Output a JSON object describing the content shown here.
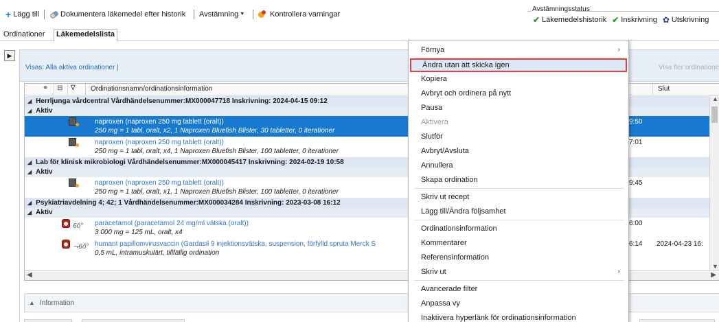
{
  "toolbar": {
    "add": "Lägg till",
    "document": "Dokumentera läkemedel efter historik",
    "reconcile": "Avstämning",
    "warnings": "Kontrollera varningar"
  },
  "status": {
    "title": "Avstämningsstatus",
    "items": [
      "Läkemedelshistorik",
      "Inskrivning",
      "Utskrivning"
    ]
  },
  "tabs": [
    "Ordinationer",
    "Läkemedelslista"
  ],
  "list": {
    "filter_text": "Visas: Alla aktiva ordinationer  |",
    "more_link": "Visa fler ordinationer",
    "col_name": "Ordinationsnamn/ordinationsinformation",
    "col_end": "Slut",
    "groups": [
      {
        "header": "Herrljunga vårdcentral  Vårdhändelsenummer:MX000047718  Inskrivning: 2024-04-15 09:12",
        "status": "Aktiv",
        "rows": [
          {
            "line1": "naproxen (naproxen 250 mg tablett (oralt))",
            "line2": "250 mg = 1 tabl, oralt, x2, 1 Naproxen Bluefish Blister, 30 tabletter, 0 iterationer",
            "time": "9:50",
            "end": ""
          },
          {
            "line1": "naproxen (naproxen 250 mg tablett (oralt))",
            "line2": "250 mg = 1 tabl, oralt, x4, 1 Naproxen Bluefish Blister, 100 tabletter, 0 iterationer",
            "time": "7:01",
            "end": ""
          }
        ]
      },
      {
        "header": "Lab för klinisk mikrobiologi  Vårdhändelsenummer:MX000045417  Inskrivning: 2024-02-19 10:58",
        "status": "Aktiv",
        "rows": [
          {
            "line1": "naproxen (naproxen 250 mg tablett (oralt))",
            "line2": "250 mg = 1 tabl, oralt, x1, 1 Naproxen Bluefish Blister, 100 tabletter, 0 iterationer",
            "time": "9:45",
            "end": ""
          }
        ]
      },
      {
        "header": "Psykiatriavdelning 4; 42; 1  Vårdhändelsenummer:MX000034284  Inskrivning: 2023-03-08 16:12",
        "status": "Aktiv",
        "rows": [
          {
            "line1": "paracetamol (paracetamol 24 mg/ml vätska (oralt))",
            "line2": "3 000 mg = 125 mL, oralt, x4",
            "time": "6:00",
            "end": ""
          },
          {
            "line1": "humant papillomvirusvaccin (Gardasil 9 injektionsvätska, suspension, förfylld spruta Merck S",
            "line2": "0,5 mL, intramuskulärt, tillfällig ordination",
            "time": "6:14",
            "end": "2024-04-23 16:"
          }
        ]
      }
    ]
  },
  "info_label": "Information",
  "context_menu": {
    "items": [
      {
        "label": "Förnya",
        "submenu": true
      },
      {
        "label": "Ändra utan att skicka igen",
        "highlighted": true
      },
      {
        "label": "Kopiera"
      },
      {
        "label": "Avbryt och ordinera på nytt"
      },
      {
        "label": "Pausa"
      },
      {
        "label": "Aktivera",
        "disabled": true
      },
      {
        "label": "Slutför"
      },
      {
        "label": "Avbryt/Avsluta"
      },
      {
        "label": "Annullera"
      },
      {
        "label": "Skapa ordination"
      },
      {
        "label": "Skriv ut recept"
      },
      {
        "label": "Lägg till/Ändra följsamhet"
      },
      {
        "label": "Ordinationsinformation"
      },
      {
        "label": "Kommentarer"
      },
      {
        "label": "Referensinformation"
      },
      {
        "label": "Skriv ut",
        "submenu": true
      },
      {
        "label": "Avancerade filter"
      },
      {
        "label": "Anpassa vy"
      },
      {
        "label": "Inaktivera hyperlänk för ordinationsinformation"
      }
    ]
  },
  "colors": {
    "selection": "#1779cf",
    "group_bg": "#dde7f3",
    "link": "#2f74c8",
    "highlight_border": "#e04040"
  }
}
